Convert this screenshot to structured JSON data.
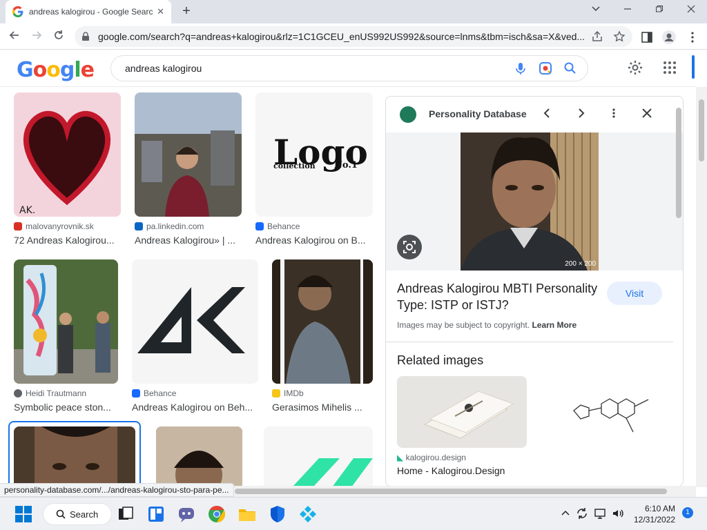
{
  "browser": {
    "tab_title": "andreas kalogirou - Google Search",
    "tab_close": "✕",
    "new_tab": "+",
    "url": "google.com/search?q=andreas+kalogirou&rlz=1C1GCEU_enUS992US992&source=lnms&tbm=isch&sa=X&ved..."
  },
  "google": {
    "logo_letters": [
      "G",
      "o",
      "o",
      "g",
      "l",
      "e"
    ],
    "logo_colors": [
      "#4285f4",
      "#ea4335",
      "#fbbc05",
      "#4285f4",
      "#34a853",
      "#ea4335"
    ],
    "query": "andreas kalogirou"
  },
  "results": [
    {
      "source": "malovanyrovnik.sk",
      "title": "72 Andreas Kalogirou...",
      "source_color": "#d93025"
    },
    {
      "source": "pa.linkedin.com",
      "title": "Andreas Kalogirou» | ...",
      "source_color": "#0a66c2"
    },
    {
      "source": "Behance",
      "title": "Andreas Kalogirou on B...",
      "source_color": "#1769ff"
    },
    {
      "source": "Heidi Trautmann",
      "title": "Symbolic peace ston...",
      "source_color": "#5f6368"
    },
    {
      "source": "Behance",
      "title": "Andreas Kalogirou on Beh...",
      "source_color": "#1769ff"
    },
    {
      "source": "IMDb",
      "title": "Gerasimos Mihelis ...",
      "source_color": "#f5c518"
    }
  ],
  "logo_thumb": {
    "big": "Logo",
    "small": "collection",
    "no": "No.1"
  },
  "panel": {
    "site": "Personality Database",
    "dims": "200 × 200",
    "title": "Andreas Kalogirou MBTI Personality Type: ISTP or ISTJ?",
    "visit": "Visit",
    "copyright": "Images may be subject to copyright.",
    "learn_more": "Learn More",
    "related_heading": "Related images",
    "related_source": "kalogirou.design",
    "related_title": "Home - Kalogirou.Design"
  },
  "status_url": "personality-database.com/.../andreas-kalogirou-sto-para-pe...",
  "taskbar": {
    "search": "Search",
    "time": "6:10 AM",
    "date": "12/31/2022",
    "notifications": "1"
  },
  "colors": {
    "accent": "#1a73e8",
    "panel_logo": "#1f7a5a"
  }
}
